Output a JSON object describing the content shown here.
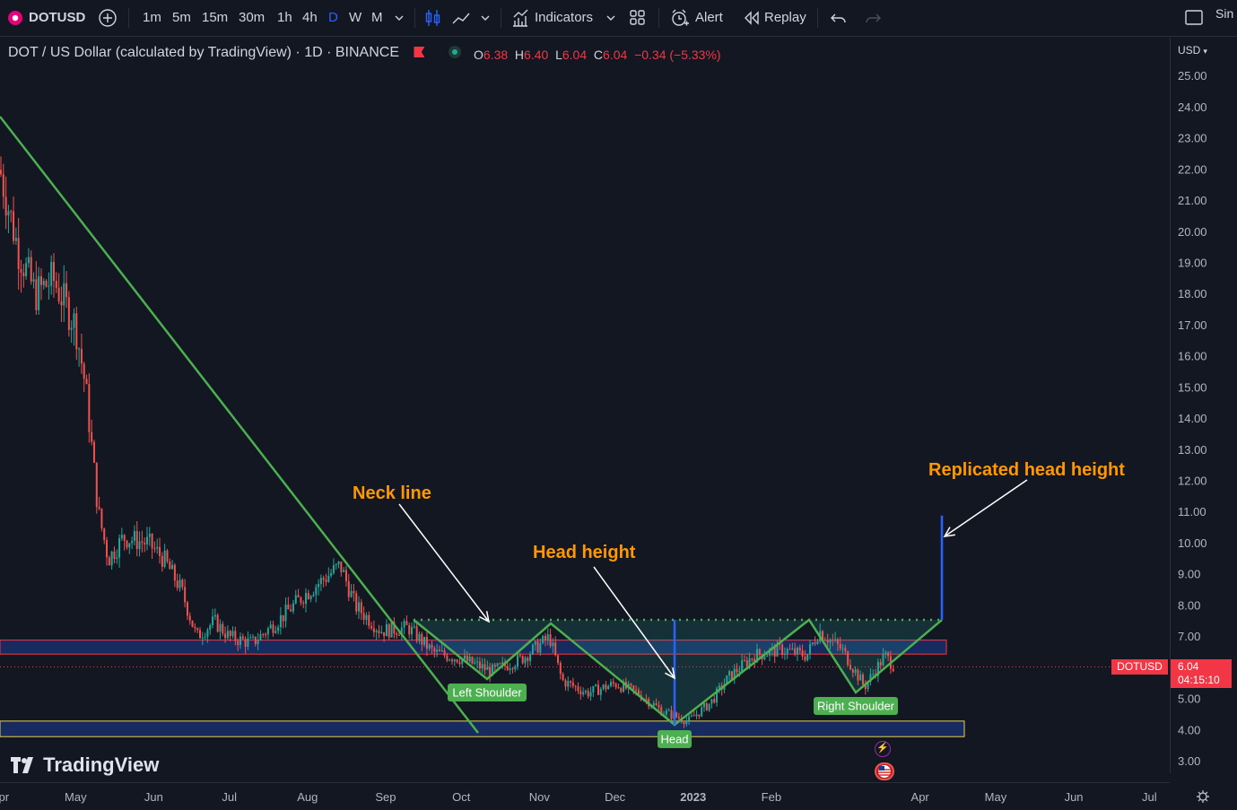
{
  "toolbar": {
    "symbol": "DOTUSD",
    "intervals": [
      "1m",
      "5m",
      "15m",
      "30m",
      "1h",
      "4h",
      "D",
      "W",
      "M"
    ],
    "active_interval": "D",
    "indicators_label": "Indicators",
    "alert_label": "Alert",
    "replay_label": "Replay",
    "right_text": "Sin"
  },
  "legend": {
    "title": "DOT / US Dollar (calculated by TradingView) · 1D · BINANCE",
    "o_key": "O",
    "o_val": "6.38",
    "h_key": "H",
    "h_val": "6.40",
    "l_key": "L",
    "l_val": "6.04",
    "c_key": "C",
    "c_val": "6.04",
    "change": "−0.34 (−5.33%)"
  },
  "currency": "USD",
  "price_badge": {
    "symbol": "DOTUSD",
    "price": "6.04",
    "countdown": "04:15:10"
  },
  "watermark": "TradingView",
  "colors": {
    "background": "#131722",
    "up": "#26a69a",
    "down": "#ef5350",
    "pattern_line": "#4caf50",
    "annotation_text": "#ff9800",
    "height_line": "#2962ff"
  },
  "chart_data": {
    "type": "candlestick",
    "y_ticks": [
      25,
      24,
      23,
      22,
      21,
      20,
      19,
      18,
      17,
      16,
      15,
      14,
      13,
      12,
      11,
      10,
      9,
      8,
      7,
      5,
      4,
      3
    ],
    "y_tick_labels": [
      "25.00",
      "24.00",
      "23.00",
      "22.00",
      "21.00",
      "20.00",
      "19.00",
      "18.00",
      "17.00",
      "16.00",
      "15.00",
      "14.00",
      "13.00",
      "12.00",
      "11.00",
      "10.00",
      "9.00",
      "8.00",
      "7.00",
      "5.00",
      "4.00",
      "3.00"
    ],
    "x_tick_labels": [
      "Apr",
      "May",
      "Jun",
      "Jul",
      "Aug",
      "Sep",
      "Oct",
      "Nov",
      "Dec",
      "2023",
      "Feb",
      "Apr",
      "May",
      "Jun",
      "Jul"
    ],
    "ylim": [
      2.4,
      26.2
    ],
    "price_path": [
      {
        "date": "2022-04-01",
        "price": 22.0
      },
      {
        "date": "2022-04-08",
        "price": 19.5
      },
      {
        "date": "2022-04-15",
        "price": 18.0
      },
      {
        "date": "2022-04-22",
        "price": 18.5
      },
      {
        "date": "2022-05-01",
        "price": 17.0
      },
      {
        "date": "2022-05-05",
        "price": 15.0
      },
      {
        "date": "2022-05-10",
        "price": 11.0
      },
      {
        "date": "2022-05-14",
        "price": 9.5
      },
      {
        "date": "2022-05-20",
        "price": 10.2
      },
      {
        "date": "2022-05-30",
        "price": 10.0
      },
      {
        "date": "2022-06-05",
        "price": 9.5
      },
      {
        "date": "2022-06-12",
        "price": 8.5
      },
      {
        "date": "2022-06-18",
        "price": 7.0
      },
      {
        "date": "2022-06-25",
        "price": 7.5
      },
      {
        "date": "2022-07-01",
        "price": 7.0
      },
      {
        "date": "2022-07-10",
        "price": 6.8
      },
      {
        "date": "2022-07-20",
        "price": 7.5
      },
      {
        "date": "2022-07-30",
        "price": 8.3
      },
      {
        "date": "2022-08-14",
        "price": 9.3
      },
      {
        "date": "2022-08-20",
        "price": 8.0
      },
      {
        "date": "2022-08-30",
        "price": 7.2
      },
      {
        "date": "2022-09-10",
        "price": 7.3
      },
      {
        "date": "2022-09-20",
        "price": 6.5
      },
      {
        "date": "2022-10-01",
        "price": 6.3
      },
      {
        "date": "2022-10-13",
        "price": 5.9
      },
      {
        "date": "2022-10-25",
        "price": 6.3
      },
      {
        "date": "2022-11-05",
        "price": 7.0
      },
      {
        "date": "2022-11-10",
        "price": 5.6
      },
      {
        "date": "2022-11-20",
        "price": 5.2
      },
      {
        "date": "2022-12-01",
        "price": 5.5
      },
      {
        "date": "2022-12-10",
        "price": 5.2
      },
      {
        "date": "2022-12-20",
        "price": 4.6
      },
      {
        "date": "2022-12-30",
        "price": 4.3
      },
      {
        "date": "2023-01-08",
        "price": 4.9
      },
      {
        "date": "2023-01-15",
        "price": 5.7
      },
      {
        "date": "2023-01-25",
        "price": 6.4
      },
      {
        "date": "2023-02-05",
        "price": 6.6
      },
      {
        "date": "2023-02-15",
        "price": 6.4
      },
      {
        "date": "2023-02-20",
        "price": 7.2
      },
      {
        "date": "2023-03-01",
        "price": 6.6
      },
      {
        "date": "2023-03-10",
        "price": 5.4
      },
      {
        "date": "2023-03-18",
        "price": 6.4
      },
      {
        "date": "2023-03-22",
        "price": 6.04
      }
    ],
    "last_price": 6.04,
    "annotations": {
      "neckline_label": "Neck line",
      "head_height_label": "Head height",
      "replicated_label": "Replicated head height",
      "left_shoulder": "Left Shoulder",
      "head": "Head",
      "right_shoulder": "Right Shoulder"
    },
    "neckline_price": 7.55,
    "projection_target": 10.9,
    "zones": [
      [
        6.45,
        6.9
      ],
      [
        3.8,
        4.3
      ]
    ]
  }
}
